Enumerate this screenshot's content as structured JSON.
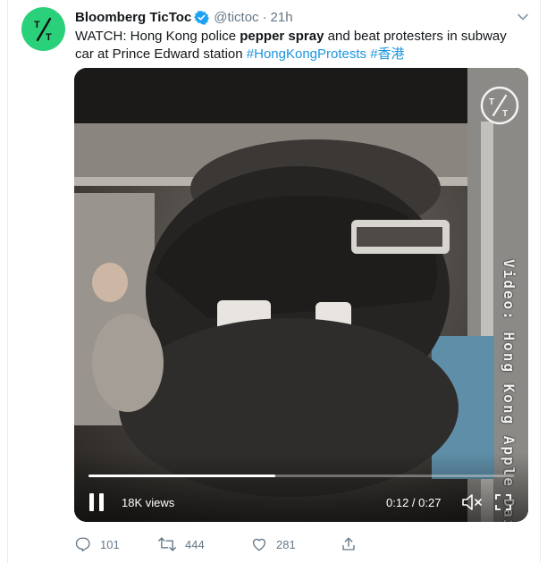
{
  "tweet": {
    "display_name": "Bloomberg TicToc",
    "handle": "@tictoc",
    "separator": "·",
    "time": "21h",
    "text_parts": {
      "t1": "WATCH: Hong Kong police ",
      "bold": "pepper spray",
      "t2": " and beat protesters in subway car at Prince Edward station ",
      "hashtag1": "#HongKongProtests",
      "space": " ",
      "hashtag2": "#香港"
    },
    "icons": {
      "avatar": "tictoc-logo-icon",
      "verified": "verified-badge-icon",
      "menu": "chevron-down-icon",
      "reply": "reply-icon",
      "retweet": "retweet-icon",
      "like": "heart-icon",
      "share": "share-icon"
    },
    "colors": {
      "avatar_bg": "#2bd07b",
      "verified": "#1da1f2",
      "hashtag": "#1b95e0",
      "muted_text": "#657786"
    }
  },
  "video": {
    "watermark": "T/T",
    "vertical_credit": "Video: Hong Kong Apple Daily",
    "views": "18K views",
    "timecode": "0:12 / 0:27",
    "progress_fraction": 0.44,
    "icons": {
      "pause": "pause-icon",
      "mute": "volume-muted-icon",
      "fullscreen": "fullscreen-icon"
    }
  },
  "actions": {
    "reply_count": "101",
    "retweet_count": "444",
    "like_count": "281"
  }
}
